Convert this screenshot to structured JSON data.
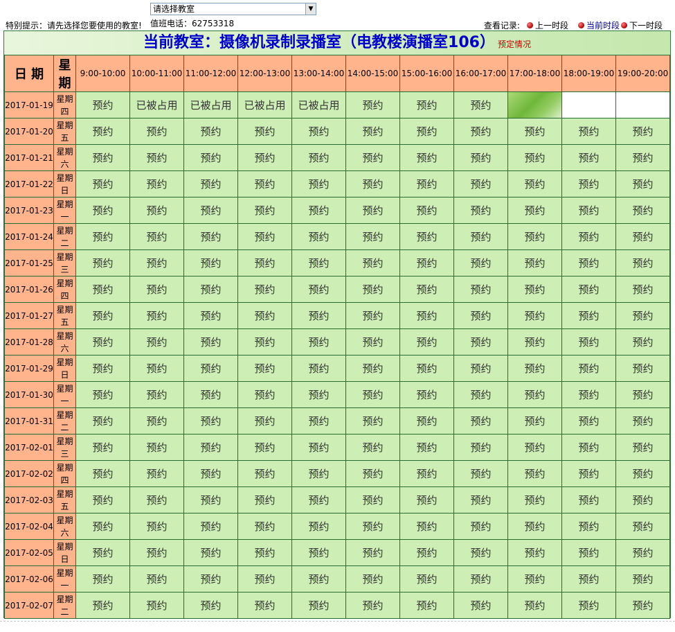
{
  "hint": "特别提示：请先选择您要使用的教室!",
  "select": {
    "value": "请选择教室"
  },
  "phone": "值班电话：62753318",
  "nav": {
    "label": "查看记录:",
    "prev": "上一时段",
    "current": "当前时段",
    "next": "下一时段"
  },
  "banner": {
    "title": "当前教室：摄像机录制录播室（电教楼演播室106）",
    "sub": "预定情况"
  },
  "headers": {
    "date": "日 期",
    "weekday": "星期",
    "slots": [
      "9:00-10:00",
      "10:00-11:00",
      "11:00-12:00",
      "12:00-13:00",
      "13:00-14:00",
      "14:00-15:00",
      "15:00-16:00",
      "16:00-17:00",
      "17:00-18:00",
      "18:00-19:00",
      "19:00-20:00"
    ]
  },
  "labels": {
    "book": "预约",
    "occupied": "已被占用"
  },
  "colors": {
    "header": "#ffb48c",
    "cell": "#cdeeb4",
    "grid": "#2a6b32",
    "title": "#0000cc"
  },
  "rows": [
    {
      "date": "2017-01-19",
      "weekday": "星期四",
      "cells": [
        "预约",
        "已被占用",
        "已被占用",
        "已被占用",
        "已被占用",
        "预约",
        "预约",
        "预约",
        "",
        "",
        ""
      ]
    },
    {
      "date": "2017-01-20",
      "weekday": "星期五",
      "cells": [
        "预约",
        "预约",
        "预约",
        "预约",
        "预约",
        "预约",
        "预约",
        "预约",
        "预约",
        "预约",
        "预约"
      ]
    },
    {
      "date": "2017-01-21",
      "weekday": "星期六",
      "cells": [
        "预约",
        "预约",
        "预约",
        "预约",
        "预约",
        "预约",
        "预约",
        "预约",
        "预约",
        "预约",
        "预约"
      ]
    },
    {
      "date": "2017-01-22",
      "weekday": "星期日",
      "cells": [
        "预约",
        "预约",
        "预约",
        "预约",
        "预约",
        "预约",
        "预约",
        "预约",
        "预约",
        "预约",
        "预约"
      ]
    },
    {
      "date": "2017-01-23",
      "weekday": "星期一",
      "cells": [
        "预约",
        "预约",
        "预约",
        "预约",
        "预约",
        "预约",
        "预约",
        "预约",
        "预约",
        "预约",
        "预约"
      ]
    },
    {
      "date": "2017-01-24",
      "weekday": "星期二",
      "cells": [
        "预约",
        "预约",
        "预约",
        "预约",
        "预约",
        "预约",
        "预约",
        "预约",
        "预约",
        "预约",
        "预约"
      ]
    },
    {
      "date": "2017-01-25",
      "weekday": "星期三",
      "cells": [
        "预约",
        "预约",
        "预约",
        "预约",
        "预约",
        "预约",
        "预约",
        "预约",
        "预约",
        "预约",
        "预约"
      ]
    },
    {
      "date": "2017-01-26",
      "weekday": "星期四",
      "cells": [
        "预约",
        "预约",
        "预约",
        "预约",
        "预约",
        "预约",
        "预约",
        "预约",
        "预约",
        "预约",
        "预约"
      ]
    },
    {
      "date": "2017-01-27",
      "weekday": "星期五",
      "cells": [
        "预约",
        "预约",
        "预约",
        "预约",
        "预约",
        "预约",
        "预约",
        "预约",
        "预约",
        "预约",
        "预约"
      ]
    },
    {
      "date": "2017-01-28",
      "weekday": "星期六",
      "cells": [
        "预约",
        "预约",
        "预约",
        "预约",
        "预约",
        "预约",
        "预约",
        "预约",
        "预约",
        "预约",
        "预约"
      ]
    },
    {
      "date": "2017-01-29",
      "weekday": "星期日",
      "cells": [
        "预约",
        "预约",
        "预约",
        "预约",
        "预约",
        "预约",
        "预约",
        "预约",
        "预约",
        "预约",
        "预约"
      ]
    },
    {
      "date": "2017-01-30",
      "weekday": "星期一",
      "cells": [
        "预约",
        "预约",
        "预约",
        "预约",
        "预约",
        "预约",
        "预约",
        "预约",
        "预约",
        "预约",
        "预约"
      ]
    },
    {
      "date": "2017-01-31",
      "weekday": "星期二",
      "cells": [
        "预约",
        "预约",
        "预约",
        "预约",
        "预约",
        "预约",
        "预约",
        "预约",
        "预约",
        "预约",
        "预约"
      ]
    },
    {
      "date": "2017-02-01",
      "weekday": "星期三",
      "cells": [
        "预约",
        "预约",
        "预约",
        "预约",
        "预约",
        "预约",
        "预约",
        "预约",
        "预约",
        "预约",
        "预约"
      ]
    },
    {
      "date": "2017-02-02",
      "weekday": "星期四",
      "cells": [
        "预约",
        "预约",
        "预约",
        "预约",
        "预约",
        "预约",
        "预约",
        "预约",
        "预约",
        "预约",
        "预约"
      ]
    },
    {
      "date": "2017-02-03",
      "weekday": "星期五",
      "cells": [
        "预约",
        "预约",
        "预约",
        "预约",
        "预约",
        "预约",
        "预约",
        "预约",
        "预约",
        "预约",
        "预约"
      ]
    },
    {
      "date": "2017-02-04",
      "weekday": "星期六",
      "cells": [
        "预约",
        "预约",
        "预约",
        "预约",
        "预约",
        "预约",
        "预约",
        "预约",
        "预约",
        "预约",
        "预约"
      ]
    },
    {
      "date": "2017-02-05",
      "weekday": "星期日",
      "cells": [
        "预约",
        "预约",
        "预约",
        "预约",
        "预约",
        "预约",
        "预约",
        "预约",
        "预约",
        "预约",
        "预约"
      ]
    },
    {
      "date": "2017-02-06",
      "weekday": "星期一",
      "cells": [
        "预约",
        "预约",
        "预约",
        "预约",
        "预约",
        "预约",
        "预约",
        "预约",
        "预约",
        "预约",
        "预约"
      ]
    },
    {
      "date": "2017-02-07",
      "weekday": "星期二",
      "cells": [
        "预约",
        "预约",
        "预约",
        "预约",
        "预约",
        "预约",
        "预约",
        "预约",
        "预约",
        "预约",
        "预约"
      ]
    }
  ]
}
